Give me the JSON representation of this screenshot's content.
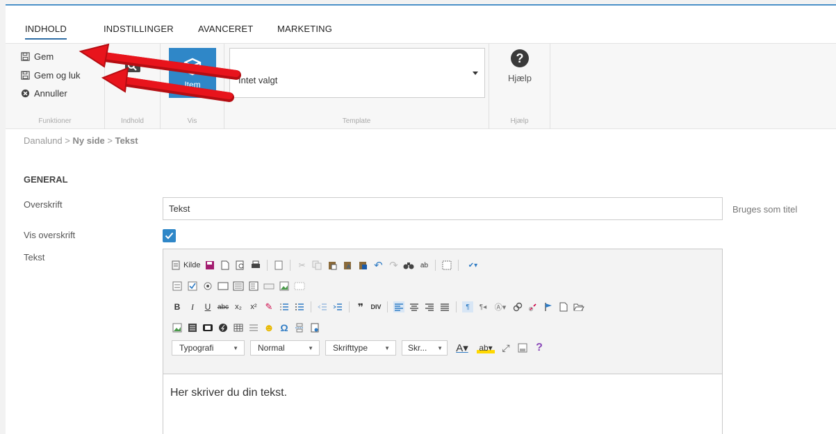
{
  "tabs": [
    {
      "label": "INDHOLD",
      "active": true
    },
    {
      "label": "INDSTILLINGER",
      "active": false
    },
    {
      "label": "AVANCERET",
      "active": false
    },
    {
      "label": "MARKETING",
      "active": false
    }
  ],
  "ribbon": {
    "functions": {
      "save": "Gem",
      "save_close": "Gem og luk",
      "cancel": "Annuller",
      "group_label": "Funktioner"
    },
    "content": {
      "button_label": "Vis",
      "group_label": "Indhold"
    },
    "view": {
      "button_label": "Item",
      "group_label": "Vis"
    },
    "template": {
      "selected": "Intet valgt",
      "group_label": "Template"
    },
    "help": {
      "button_label": "Hjælp",
      "group_label": "Hjælp"
    }
  },
  "breadcrumb": {
    "root": "Danalund",
    "page": "Ny side",
    "item": "Tekst",
    "separator": ">"
  },
  "form": {
    "section_title": "GENERAL",
    "heading_label": "Overskrift",
    "heading_value": "Tekst",
    "heading_hint": "Bruges som titel",
    "show_heading_label": "Vis overskrift",
    "show_heading_checked": true,
    "text_label": "Tekst"
  },
  "editor": {
    "source_label": "Kilde",
    "combos": {
      "format": "Typografi",
      "style": "Normal",
      "font": "Skrifttype",
      "size": "Skr..."
    },
    "content": "Her skriver du din tekst."
  },
  "colors": {
    "accent": "#2f87c8",
    "arrow": "#e8141c"
  }
}
